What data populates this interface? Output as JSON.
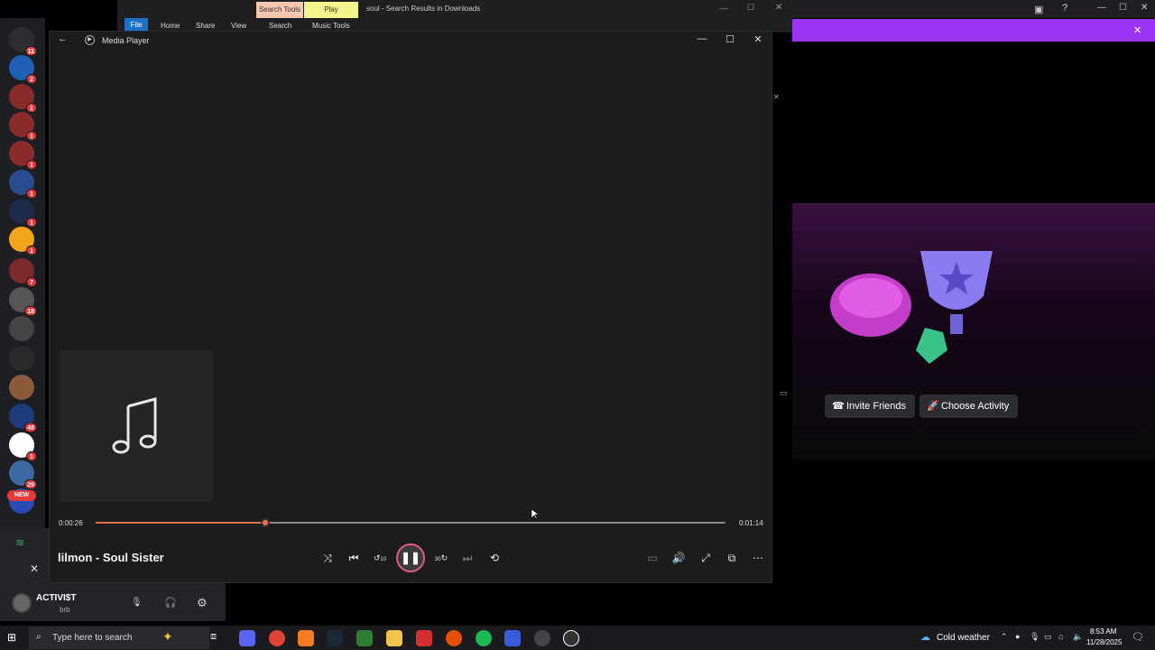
{
  "explorer": {
    "title": "soul - Search Results in Downloads",
    "context_tabs": [
      "Search Tools",
      "Play"
    ],
    "tabs": [
      "File",
      "Home",
      "Share",
      "View",
      "Search",
      "Music Tools"
    ]
  },
  "player": {
    "title": "Media Player",
    "time_current": "0:00:26",
    "time_total": "0:01:14",
    "progress_fraction": 0.27,
    "song": "lilmon - Soul Sister",
    "play_state_icon": "pause-icon",
    "skip_back_label": "10",
    "skip_forward_label": "30"
  },
  "discord": {
    "user_name": "ACTIVI$T",
    "user_status": "brb",
    "new_badge": "NEW",
    "server_badges": [
      "11",
      "2",
      "1",
      "1",
      "1",
      "1",
      "1",
      "1",
      "7",
      "18",
      "1",
      "48",
      "1",
      "29"
    ],
    "activity_buttons": {
      "invite": "Invite Friends",
      "choose": "Choose Activity"
    }
  },
  "taskbar": {
    "search_placeholder": "Type here to search",
    "weather": "Cold weather",
    "time": "8:53 AM",
    "date": "11/28/2025"
  },
  "colors": {
    "accent": "#e8704f",
    "play_ring": "#e2568c",
    "discord_purple": "#9b35f5"
  }
}
